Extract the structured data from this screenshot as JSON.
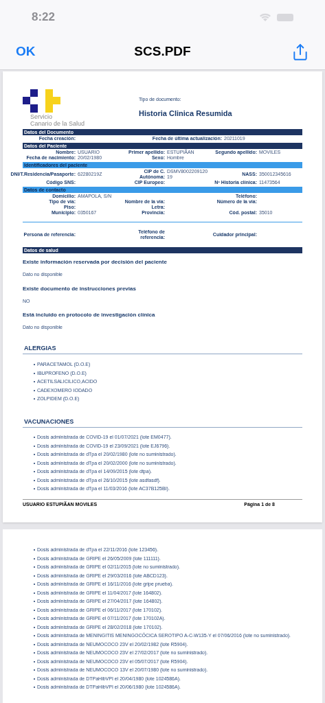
{
  "status_bar": {
    "time": "8:22"
  },
  "nav": {
    "done": "OK",
    "title": "SCS.PDF"
  },
  "page_1": {
    "logo": {
      "line_1": "Servicio",
      "line_2": "Canario de la Salud"
    },
    "doc_type_label": "Tipo de documento:",
    "doc_title": "Historia Clinica Resumida",
    "sections": [
      {
        "title": "Datos del Documento",
        "kind": "dark",
        "rows": [
          [
            {
              "label": "Fecha creación:"
            },
            "",
            {
              "label": "Fecha de última actualización:",
              "value": "20211019"
            }
          ]
        ]
      },
      {
        "title": "Datos del Paciente",
        "kind": "dark",
        "rows": [
          [
            {
              "label": "Nombre:",
              "value": "USUARIO"
            },
            {
              "label": "Primer apellido:",
              "value": "ESTUPIÃAN"
            },
            {
              "label": "Segundo apellido:",
              "value": "MOVILES"
            }
          ],
          [
            {
              "label": "Fecha de nacimiento:",
              "value": "20/02/1980"
            },
            {
              "label": "Sexo:",
              "value": "Hombre"
            },
            ""
          ]
        ]
      },
      {
        "title": "Identificadores del paciente",
        "kind": "light",
        "rows": [
          [
            {
              "label": "DNI/T.Residencia/Pasaporte:",
              "value": "62280219Z"
            },
            {
              "label": "CIP de C. Autónoma:",
              "value": "DSMV800220912019"
            },
            {
              "label": "NASS:",
              "value": "350012345616"
            }
          ],
          [
            {
              "label": "Código SNS:"
            },
            {
              "label": "CIP Europeo:"
            },
            {
              "label": "Nº Historia clínica:",
              "value": "11473564"
            }
          ]
        ]
      },
      {
        "title": "Datos de contacto",
        "kind": "light",
        "rows": [
          [
            {
              "label": "Domicilio:",
              "value": "AMAPOLA, S/N"
            },
            "",
            {
              "label": "Teléfono:"
            }
          ],
          [
            {
              "label": "Tipo de vía:"
            },
            {
              "label": "Nombre de la vía:"
            },
            {
              "label": "Número de la vía:"
            }
          ],
          [
            {
              "label": "Piso:"
            },
            {
              "label": "Letra:"
            },
            ""
          ],
          [
            {
              "label": "Municipio:",
              "value": "0350167"
            },
            {
              "label": "Provincia:"
            },
            {
              "label": "Cód. postal:",
              "value": "35010"
            }
          ]
        ]
      }
    ],
    "reference_row": [
      {
        "label": "Persona de referencia:"
      },
      {
        "label": "Teléfono de referencia:"
      },
      {
        "label": "Cuidador principal:"
      }
    ],
    "health": {
      "title": "Datos de salud",
      "kind": "dark",
      "items": [
        {
          "question": "Existe información reservada por decisión del paciente",
          "answer": "Dato no disponible"
        },
        {
          "question": "Existe documento de instrucciones previas",
          "answer": "NO"
        },
        {
          "question": "Está incluido en protocolo de investigación clínica",
          "answer": "Dato no disponible"
        }
      ]
    },
    "allergies": {
      "title": "ALERGIAS",
      "items": [
        "PARACETAMOL (D.O.E)",
        "IBUPROFENO (D.O.E)",
        "ACETILSALICILICO,ACIDO",
        "CADEXOMERO IODADO",
        "ZOLPIDEM (D.O.E)"
      ]
    },
    "vaccinations": {
      "title": "VACUNACIONES",
      "items": [
        "Dosis administrada de COVID-19 el 01/07/2021 (lote EM0477).",
        "Dosis administrada de COVID-19 el 23/09/2021 (lote EJ6796).",
        "Dosis administrada de dTpa el 20/02/1980 (lote no suministrado).",
        "Dosis administrada de dTpa el 20/02/2000 (lote no suministrado).",
        "Dosis administrada de dTpa el 14/09/2015 (lote dtpa).",
        "Dosis administrada de dTpa el 26/10/2015 (lote asdfasdf).",
        "Dosis administrada de dTpa el 11/03/2016 (lote AC37B125BI)."
      ]
    },
    "footer": {
      "patient": "USUARIO ESTUPIÃAN MOVILES",
      "page": "Página 1 de 8"
    }
  },
  "page_2": {
    "items": [
      "Dosis administrada de dTpa el 22/11/2016 (lote 123456).",
      "Dosis administrada de GRIPE el 26/05/2009 (lote 111111).",
      "Dosis administrada de GRIPE el 02/11/2015 (lote no suministrado).",
      "Dosis administrada de GRIPE el 29/03/2016 (lote ABCD123).",
      "Dosis administrada de GRIPE el 16/11/2016 (lote gripe prueba).",
      "Dosis administrada de GRIPE el 11/04/2017 (lote 164802).",
      "Dosis administrada de GRIPE el 27/04/2017 (lote 164802).",
      "Dosis administrada de GRIPE el 06/11/2017 (lote 170102).",
      "Dosis administrada de GRIPE el 07/11/2017 (lote 170102A).",
      "Dosis administrada de GRIPE el 28/02/2018 (lote 170102).",
      "Dosis administrada de MENINGITIS MENINGOCÓCICA SEROTIPO A-C-W135-Y el 07/06/2016 (lote no suministrado).",
      "Dosis administrada de NEUMOCOCO 23V el 20/02/1982 (lote R5904).",
      "Dosis administrada de NEUMOCOCO 23V el 27/02/2017 (lote no suministrado).",
      "Dosis administrada de NEUMOCOCO 23V el 05/07/2017 (lote R5904).",
      "Dosis administrada de NEUMOCOCO 13V el 20/07/1980 (lote no suministrado).",
      "Dosis administrada de DTPaHibVPI el 20/04/1980 (lote 1024586A).",
      "Dosis administrada de DTPaHibVPI el 20/06/1980 (lote 1024586A)."
    ]
  }
}
